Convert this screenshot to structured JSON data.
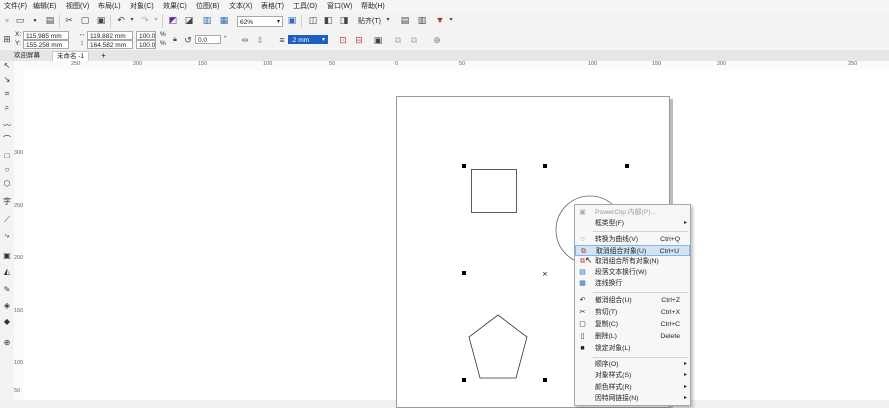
{
  "menubar": {
    "items": [
      "文件(F)",
      "编辑(E)",
      "视图(V)",
      "布局(L)",
      "对象(C)",
      "效果(C)",
      "位图(B)",
      "文本(X)",
      "表格(T)",
      "工具(O)",
      "窗口(W)",
      "帮助(H)"
    ]
  },
  "toolbar1": {
    "zoom": "62%",
    "snap_label": "贴齐(T)"
  },
  "toolbar2": {
    "x_label": "X:",
    "x_value": "115.985 mm",
    "y_label": "Y:",
    "y_value": "155.258 mm",
    "w_value": "119.882 mm",
    "h_value": "164.582 mm",
    "sx_value": "100.0",
    "sy_value": "100.0",
    "pct": "%",
    "rotation_value": "0.0",
    "degree": "°",
    "outline_value": ".2 mm"
  },
  "tabs": {
    "welcome": "欢迎屏幕",
    "doc": "未命名 -1",
    "add": "+"
  },
  "hruler": {
    "labels": [
      "250",
      "200",
      "150",
      "100",
      "50",
      "0",
      "50",
      "100",
      "150",
      "200",
      "250"
    ]
  },
  "vruler": {
    "labels": [
      "300",
      "250",
      "200",
      "150",
      "100",
      "50"
    ]
  },
  "context_menu": {
    "powerclip": "PowerClip 内部(P)...",
    "frame_type": "框类型(F)",
    "convert_curve": "转换为曲线(V)",
    "convert_curve_sc": "Ctrl+Q",
    "ungroup": "取消组合对象(U)",
    "ungroup_sc": "Ctrl+U",
    "ungroup_all": "取消组合所有对象(N)",
    "para_wrap": "段落文本换行(W)",
    "link_wrap": "连线换行",
    "undo_group": "撤消组合(U)",
    "undo_group_sc": "Ctrl+Z",
    "cut": "剪切(T)",
    "cut_sc": "Ctrl+X",
    "copy": "复制(C)",
    "copy_sc": "Ctrl+C",
    "delete": "删除(L)",
    "delete_sc": "Delete",
    "lock": "锁定对象(L)",
    "order": "顺序(O)",
    "obj_style": "对象样式(S)",
    "color_style": "颜色样式(R)",
    "internet_link": "因特网链接(N)"
  }
}
